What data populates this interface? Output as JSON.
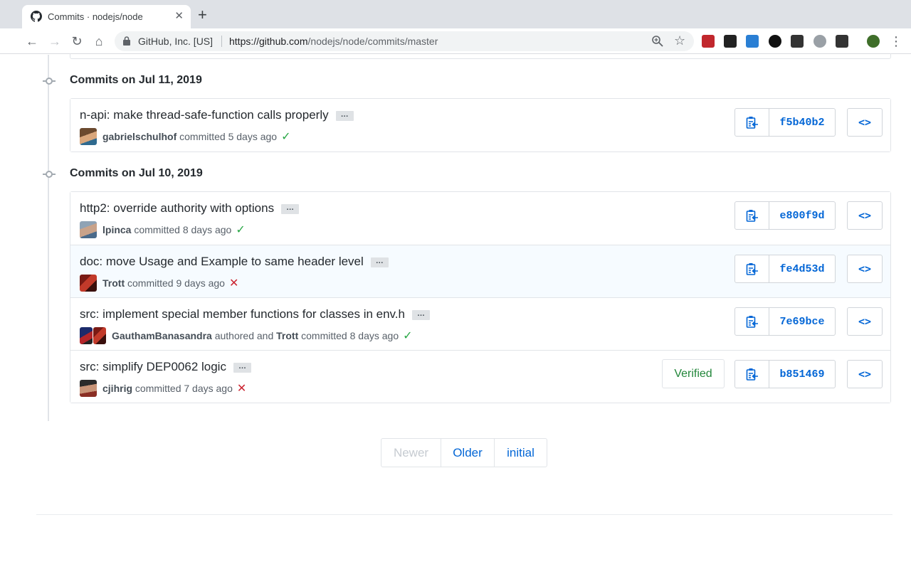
{
  "browser": {
    "tab_title": "Commits · nodejs/node",
    "close_glyph": "✕",
    "new_tab_glyph": "+",
    "back_glyph": "←",
    "forward_glyph": "→",
    "reload_glyph": "↻",
    "home_glyph": "⌂",
    "site_identity": "GitHub, Inc. [US]",
    "url_host": "https://github.com",
    "url_path": "/nodejs/node/commits/master",
    "star_glyph": "☆",
    "menu_glyph": "⋮",
    "extensions": [
      {
        "name": "ublock-extension-icon",
        "color": "#c1272d"
      },
      {
        "name": "terminal-extension-icon",
        "color": "#222222"
      },
      {
        "name": "s-extension-icon",
        "color": "#2a7fd4"
      },
      {
        "name": "circle-extension-icon",
        "color": "#111111"
      },
      {
        "name": "chat-extension-icon",
        "color": "#333333"
      },
      {
        "name": "gear-extension-icon",
        "color": "#9aa0a6"
      },
      {
        "name": "comment-extension-icon",
        "color": "#333333"
      },
      {
        "name": "avatar-extension-icon",
        "color": "#3f6e2a"
      }
    ]
  },
  "groups": [
    {
      "title": "Commits on Jul 11, 2019",
      "commits": [
        {
          "message": "n-api: make thread-safe-function calls properly",
          "ellipsis": "…",
          "author": "gabrielschulhof",
          "action": "committed 5 days ago",
          "status": "success",
          "status_glyph": "✓",
          "sha": "f5b40b2",
          "highlighted": false
        }
      ]
    },
    {
      "title": "Commits on Jul 10, 2019",
      "commits": [
        {
          "message": "http2: override authority with options",
          "ellipsis": "…",
          "author": "lpinca",
          "action": "committed 8 days ago",
          "status": "success",
          "status_glyph": "✓",
          "sha": "e800f9d",
          "highlighted": false
        },
        {
          "message": "doc: move Usage and Example to same header level",
          "ellipsis": "…",
          "author": "Trott",
          "action": "committed 9 days ago",
          "status": "failure",
          "status_glyph": "✕",
          "sha": "fe4d53d",
          "highlighted": true
        },
        {
          "message": "src: implement special member functions for classes in env.h",
          "ellipsis": "…",
          "author": "GauthamBanasandra",
          "authored_label": "authored and",
          "committer": "Trott",
          "action": "committed 8 days ago",
          "status": "success",
          "status_glyph": "✓",
          "sha": "7e69bce",
          "highlighted": false
        },
        {
          "message": "src: simplify DEP0062 logic",
          "ellipsis": "…",
          "author": "cjihrig",
          "action": "committed 7 days ago",
          "status": "failure",
          "status_glyph": "✕",
          "sha": "b851469",
          "verified_label": "Verified",
          "highlighted": false
        }
      ]
    }
  ],
  "browse_glyph": "<>",
  "pagination": {
    "newer": "Newer",
    "older": "Older",
    "initial": "initial"
  },
  "colors": {
    "link": "#0366d6",
    "success": "#28a745",
    "failure": "#cb2431",
    "verified": "#22863a"
  }
}
